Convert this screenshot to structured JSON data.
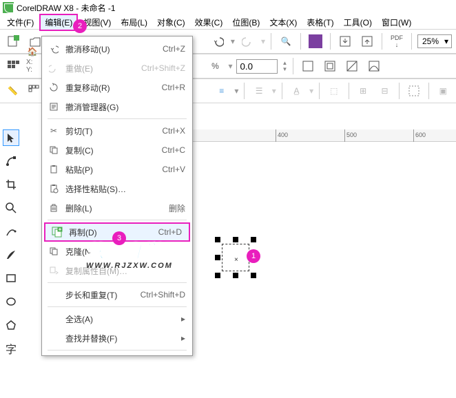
{
  "title": "CorelDRAW X8 - 未命名 -1",
  "menubar": {
    "file": "文件(F)",
    "edit": "编辑(E)",
    "view": "视图(V)",
    "layout": "布局(L)",
    "object": "对象(C)",
    "effect": "效果(C)",
    "bitmap": "位图(B)",
    "text": "文本(X)",
    "table": "表格(T)",
    "tool": "工具(O)",
    "window": "窗口(W)"
  },
  "edit_menu": {
    "undo": {
      "label": "撤消移动(U)",
      "shortcut": "Ctrl+Z"
    },
    "redo": {
      "label": "重做(E)",
      "shortcut": "Ctrl+Shift+Z"
    },
    "repeat": {
      "label": "重复移动(R)",
      "shortcut": "Ctrl+R"
    },
    "undo_manager": {
      "label": "撤消管理器(G)"
    },
    "cut": {
      "label": "剪切(T)",
      "shortcut": "Ctrl+X"
    },
    "copy": {
      "label": "复制(C)",
      "shortcut": "Ctrl+C"
    },
    "paste": {
      "label": "粘贴(P)",
      "shortcut": "Ctrl+V"
    },
    "paste_special": {
      "label": "选择性粘贴(S)…"
    },
    "delete": {
      "label": "删除(L)",
      "shortcut": "删除"
    },
    "duplicate": {
      "label": "再制(D)",
      "shortcut": "Ctrl+D"
    },
    "clone": {
      "label": "克隆(N)"
    },
    "copy_props": {
      "label": "复制属性自(M)…"
    },
    "step_repeat": {
      "label": "步长和重复(T)",
      "shortcut": "Ctrl+Shift+D"
    },
    "select_all": {
      "label": "全选(A)"
    },
    "find_replace": {
      "label": "查找并替换(F)"
    }
  },
  "toolbar": {
    "zoom": "25%",
    "num_value": "0.0",
    "pdf_label": "PDF",
    "percent": "%"
  },
  "ruler": {
    "t400": "400",
    "t500": "500",
    "t600": "600"
  },
  "watermark": {
    "main": "软件自学网",
    "sub": "WWW.RJZXW.COM"
  },
  "badges": {
    "b1": "1",
    "b2": "2",
    "b3": "3"
  }
}
